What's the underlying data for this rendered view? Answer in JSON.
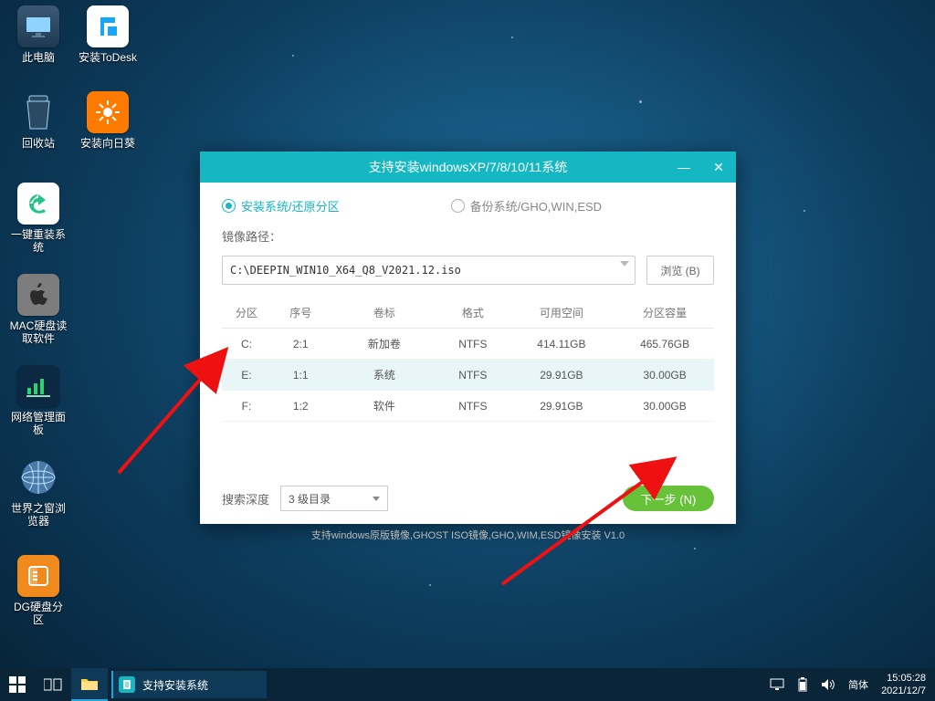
{
  "desktop_icons": [
    {
      "label": "此电脑",
      "key": "pc"
    },
    {
      "label": "安装ToDesk",
      "key": "todesk"
    },
    {
      "label": "回收站",
      "key": "recycle"
    },
    {
      "label": "安装向日葵",
      "key": "sunlogin"
    },
    {
      "label": "一键重装系统",
      "key": "reinstall"
    },
    {
      "label": "MAC硬盘读取软件",
      "key": "mac"
    },
    {
      "label": "网络管理面板",
      "key": "netpanel"
    },
    {
      "label": "世界之窗浏览器",
      "key": "browser"
    },
    {
      "label": "DG硬盘分区",
      "key": "dg"
    }
  ],
  "dialog": {
    "title": "支持安装windowsXP/7/8/10/11系统",
    "radio_install": "安装系统/还原分区",
    "radio_backup": "备份系统/GHO,WIN,ESD",
    "image_path_label": "镜像路径：",
    "image_path_value": "C:\\DEEPIN_WIN10_X64_Q8_V2021.12.iso",
    "browse": "浏览 (B)",
    "columns": {
      "part": "分区",
      "seq": "序号",
      "vol": "卷标",
      "fmt": "格式",
      "free": "可用空间",
      "cap": "分区容量"
    },
    "rows": [
      {
        "part": "C:",
        "seq": "2:1",
        "vol": "新加卷",
        "fmt": "NTFS",
        "free": "414.11GB",
        "cap": "465.76GB",
        "sel": false
      },
      {
        "part": "E:",
        "seq": "1:1",
        "vol": "系统",
        "fmt": "NTFS",
        "free": "29.91GB",
        "cap": "30.00GB",
        "sel": true
      },
      {
        "part": "F:",
        "seq": "1:2",
        "vol": "软件",
        "fmt": "NTFS",
        "free": "29.91GB",
        "cap": "30.00GB",
        "sel": false
      }
    ],
    "search_depth_label": "搜索深度",
    "search_depth_value": "3 级目录",
    "next": "下一步 (N)",
    "footer": "支持windows原版镜像,GHOST ISO镜像,GHO,WIM,ESD镜像安装   V1.0"
  },
  "taskbar": {
    "app_title": "支持安装系统",
    "ime": "简体",
    "time": "15:05:28",
    "date": "2021/12/7"
  }
}
